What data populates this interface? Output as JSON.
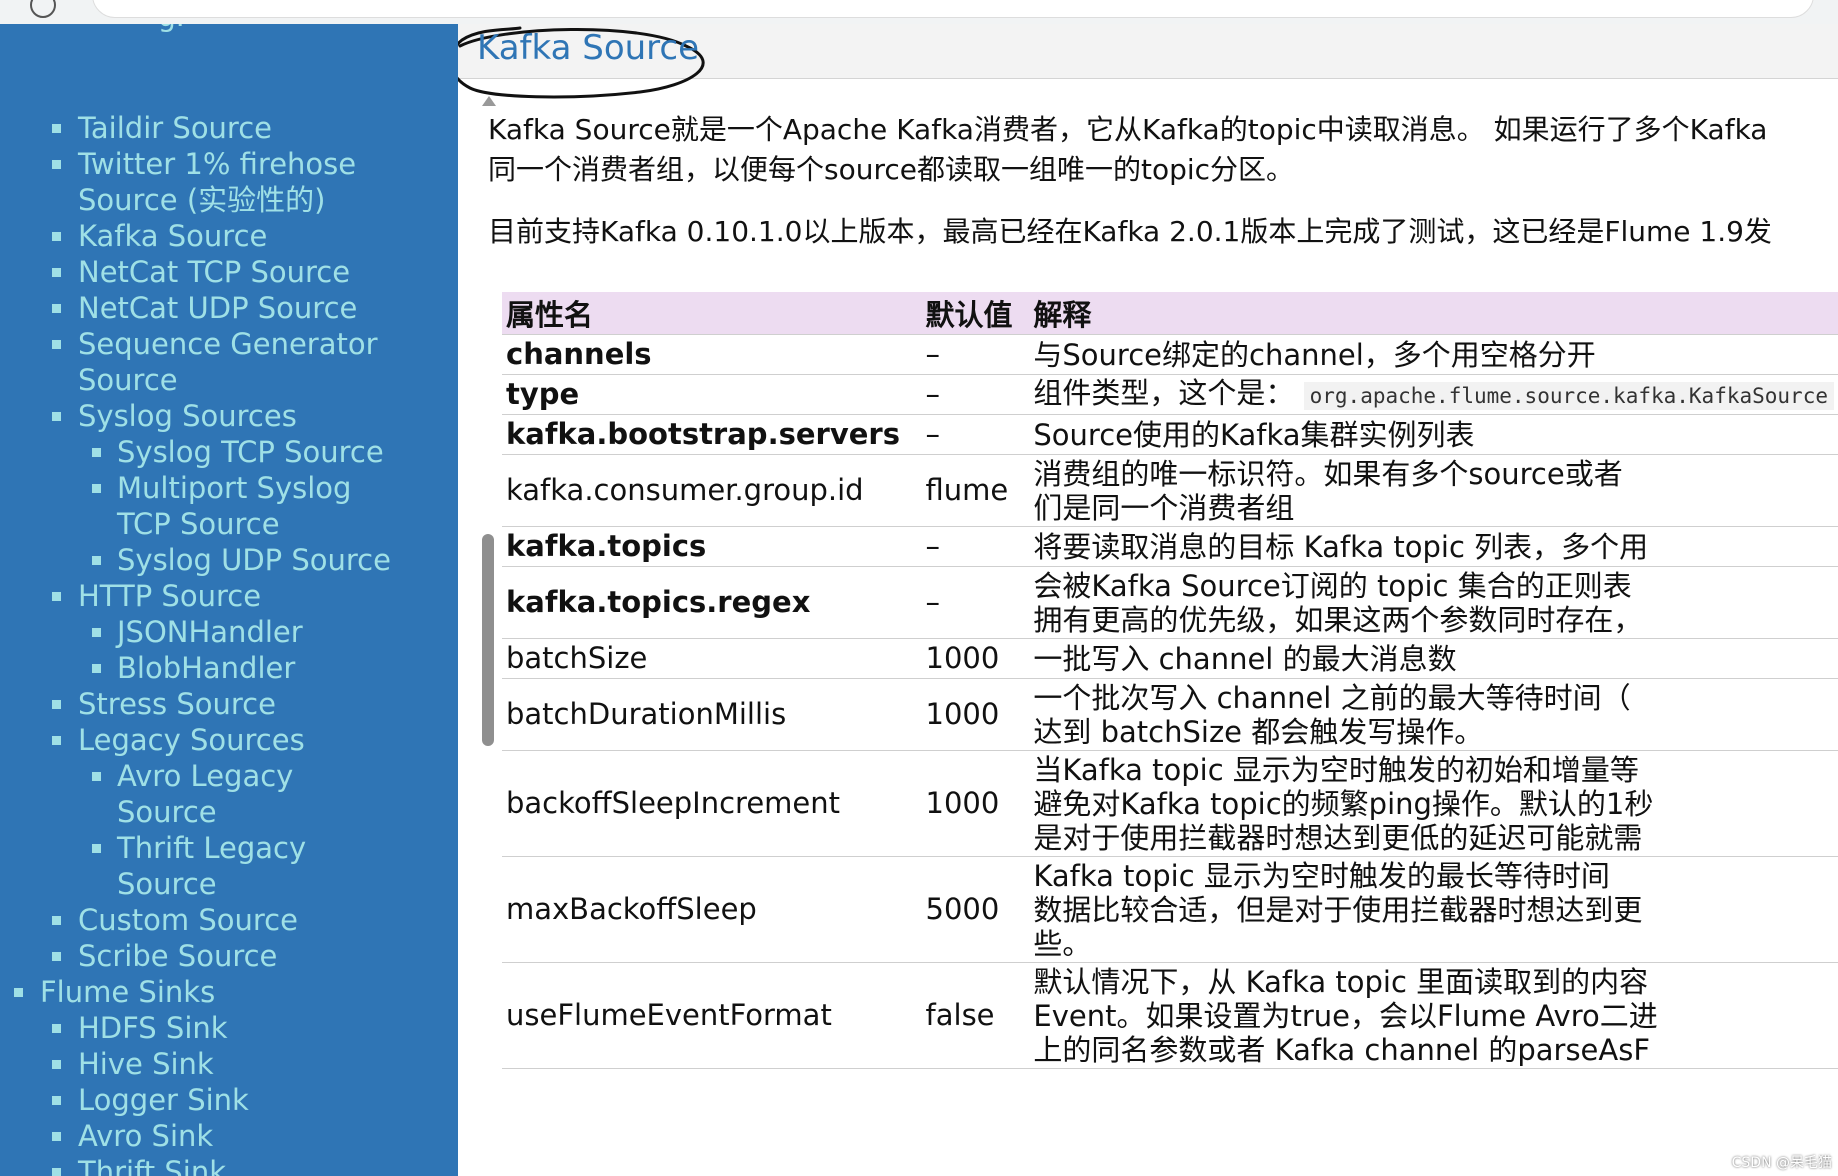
{
  "sidebar": {
    "items": [
      {
        "label": "Taildir Source",
        "level": 1
      },
      {
        "label": "Twitter 1% firehose",
        "level": 1
      },
      {
        "label": "Source (实验性的)",
        "level": 1,
        "continuation": true
      },
      {
        "label": "Kafka Source",
        "level": 1
      },
      {
        "label": "NetCat TCP Source",
        "level": 1
      },
      {
        "label": "NetCat UDP Source",
        "level": 1
      },
      {
        "label": "Sequence Generator",
        "level": 1
      },
      {
        "label": "Source",
        "level": 1,
        "continuation": true
      },
      {
        "label": "Syslog Sources",
        "level": 1
      },
      {
        "label": "Syslog TCP Source",
        "level": 2
      },
      {
        "label": "Multiport Syslog",
        "level": 2
      },
      {
        "label": "TCP Source",
        "level": 2,
        "continuation": true
      },
      {
        "label": "Syslog UDP Source",
        "level": 2
      },
      {
        "label": "HTTP Source",
        "level": 1
      },
      {
        "label": "JSONHandler",
        "level": 2
      },
      {
        "label": "BlobHandler",
        "level": 2
      },
      {
        "label": "Stress Source",
        "level": 1
      },
      {
        "label": "Legacy Sources",
        "level": 1
      },
      {
        "label": "Avro Legacy",
        "level": 2
      },
      {
        "label": "Source",
        "level": 2,
        "continuation": true
      },
      {
        "label": "Thrift Legacy",
        "level": 2
      },
      {
        "label": "Source",
        "level": 2,
        "continuation": true
      },
      {
        "label": "Custom Source",
        "level": 1
      },
      {
        "label": "Scribe Source",
        "level": 1
      },
      {
        "label": "Flume Sinks",
        "level": 0
      },
      {
        "label": "HDFS Sink",
        "level": 1
      },
      {
        "label": "Hive Sink",
        "level": 1
      },
      {
        "label": "Logger Sink",
        "level": 1
      },
      {
        "label": "Avro Sink",
        "level": 1
      },
      {
        "label": "Thrift Sink",
        "level": 1
      }
    ]
  },
  "page": {
    "title": "Kafka Source",
    "para1_line1": "Kafka Source就是一个Apache Kafka消费者，它从Kafka的topic中读取消息。 如果运行了多个Kafka",
    "para1_line2": "同一个消费者组，以便每个source都读取一组唯一的topic分区。",
    "para2": "目前支持Kafka 0.10.1.0以上版本，最高已经在Kafka 2.0.1版本上完成了测试，这已经是Flume 1.9发"
  },
  "table": {
    "headers": [
      "属性名",
      "默认值",
      "解释"
    ],
    "rows": [
      {
        "name": "channels",
        "bold": true,
        "default": "–",
        "desc": [
          "与Source绑定的channel，多个用空格分开"
        ]
      },
      {
        "name": "type",
        "bold": true,
        "default": "–",
        "desc": [
          "组件类型，这个是："
        ],
        "code": "org.apache.flume.source.kafka.KafkaSource"
      },
      {
        "name": "kafka.bootstrap.servers",
        "bold": true,
        "default": "–",
        "desc": [
          "Source使用的Kafka集群实例列表"
        ]
      },
      {
        "name": "kafka.consumer.group.id",
        "bold": false,
        "default": "flume",
        "desc": [
          "消费组的唯一标识符。如果有多个source或者",
          "们是同一个消费者组"
        ]
      },
      {
        "name": "kafka.topics",
        "bold": true,
        "default": "–",
        "desc": [
          "将要读取消息的目标 Kafka topic 列表，多个用"
        ]
      },
      {
        "name": "kafka.topics.regex",
        "bold": true,
        "default": "–",
        "desc": [
          "会被Kafka Source订阅的 topic 集合的正则表",
          "拥有更高的优先级，如果这两个参数同时存在，"
        ]
      },
      {
        "name": "batchSize",
        "bold": false,
        "default": "1000",
        "desc": [
          "一批写入 channel 的最大消息数"
        ]
      },
      {
        "name": "batchDurationMillis",
        "bold": false,
        "default": "1000",
        "desc": [
          "一个批次写入 channel 之前的最大等待时间（",
          "达到 batchSize 都会触发写操作。"
        ]
      },
      {
        "name": "backoffSleepIncrement",
        "bold": false,
        "default": "1000",
        "desc": [
          "当Kafka topic 显示为空时触发的初始和增量等",
          "避免对Kafka topic的频繁ping操作。默认的1秒",
          "是对于使用拦截器时想达到更低的延迟可能就需"
        ]
      },
      {
        "name": "maxBackoffSleep",
        "bold": false,
        "default": "5000",
        "desc": [
          "Kafka topic 显示为空时触发的最长等待时间",
          "数据比较合适，但是对于使用拦截器时想达到更",
          "些。"
        ]
      },
      {
        "name": "useFlumeEventFormat",
        "bold": false,
        "default": "false",
        "desc": [
          "默认情况下，从 Kafka topic 里面读取到的内容",
          "Event。如果设置为true，会以Flume Avro二进",
          "上的同名参数或者 Kafka channel 的parseAsF"
        ]
      }
    ]
  },
  "watermark": "CSDN @呆毛猫",
  "colors": {
    "sidebar": "#2f75b5",
    "link": "#9fe0e6",
    "title": "#2f75b5",
    "header": "#eddcf1"
  }
}
